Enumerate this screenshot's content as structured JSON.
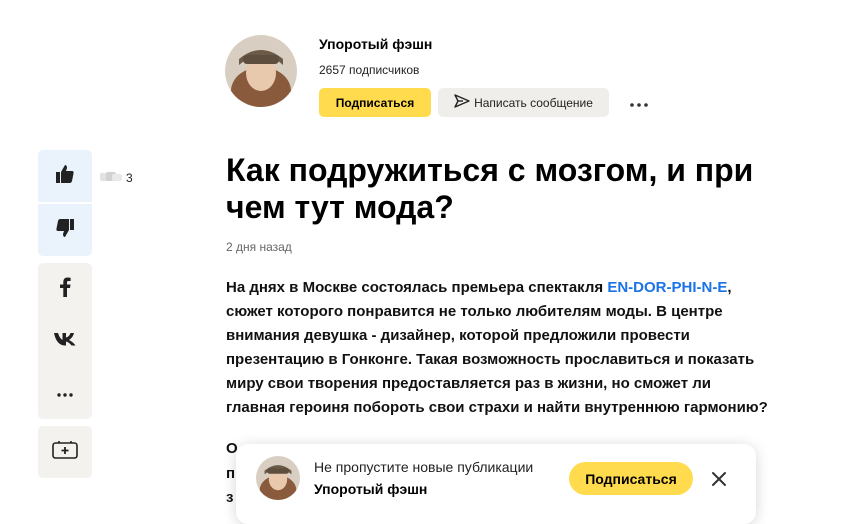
{
  "channel": {
    "name": "Упоротый фэшн",
    "subscribers": "2657 подписчиков",
    "subscribe_label": "Подписаться",
    "message_label": "Написать сообщение"
  },
  "reactions": {
    "like_count": "3"
  },
  "article": {
    "title": "Как подружиться с мозгом, и при чем тут мода?",
    "date": "2 дня назад",
    "lead_before_link": "На днях в Москве состоялась премьера спектакля ",
    "lead_link": "EN-DOR-PHI-N-E",
    "lead_after_link": ", сюжет которого понравится не только любителям моды. В центре внимания девушка - дизайнер, которой предложили провести презентацию в Гонконге. Такая возможность прославиться и показать миру свои творения предоставляется раз в жизни, но сможет ли главная героиня побороть свои страхи и найти внутреннюю гармонию?",
    "cut_1": "О",
    "cut_2": "п",
    "cut_3": "з"
  },
  "popup": {
    "text": "Не пропустите новые публикации",
    "channel_name": "Упоротый фэшн",
    "subscribe_label": "Подписаться"
  },
  "icons": {
    "like": "thumbs-up-icon",
    "dislike": "thumbs-down-icon",
    "facebook": "facebook-icon",
    "vk": "vk-icon",
    "more": "more-dots-icon",
    "save": "add-bookmark-icon",
    "send": "send-icon",
    "close": "close-icon"
  },
  "colors": {
    "accent_yellow": "#ffdb4d",
    "link_blue": "#1a73e8",
    "panel_grey": "#f4f2ef",
    "reaction_blue": "#eaf2fb"
  }
}
